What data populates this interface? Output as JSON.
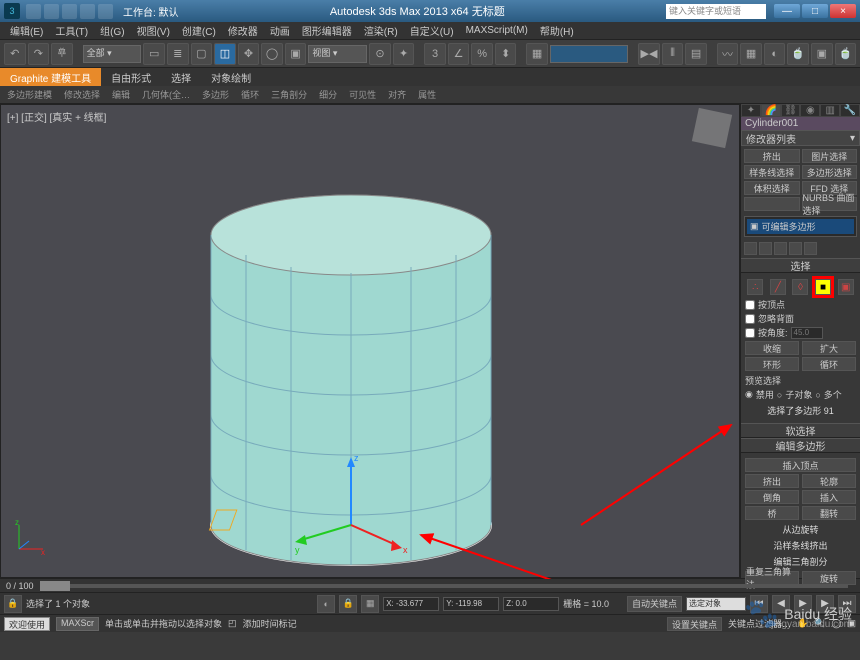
{
  "titlebar": {
    "workspace_label": "工作台: 默认",
    "app_title": "Autodesk 3ds Max  2013 x64   无标题",
    "search_placeholder": "键入关键字或短语",
    "min": "—",
    "max": "□",
    "close": "×"
  },
  "menu": [
    "编辑(E)",
    "工具(T)",
    "组(G)",
    "视图(V)",
    "创建(C)",
    "修改器",
    "动画",
    "图形编辑器",
    "渲染(R)",
    "自定义(U)",
    "MAXScript(M)",
    "帮助(H)"
  ],
  "toolbar_dropdown_all": "全部 ▾",
  "toolbar_dropdown_view": "视图 ▾",
  "ribbon": {
    "tabs": [
      "Graphite 建模工具",
      "自由形式",
      "选择",
      "对象绘制"
    ],
    "subtabs": [
      "多边形建模",
      "修改选择",
      "编辑",
      "几何体(全…",
      "多边形",
      "循环",
      "三角剖分",
      "细分",
      "可见性",
      "对齐",
      "属性"
    ]
  },
  "viewport_label": "[+] [正交] [真实 + 线框]",
  "panel": {
    "object_name": "Cylinder001",
    "modifier_list": "修改器列表",
    "buttons_top": [
      "挤出",
      "图片选择",
      "样条线选择",
      "多边形选择",
      "体积选择",
      "FFD 选择",
      "",
      "NURBS 曲面选择"
    ],
    "stack_item": "可编辑多边形",
    "rollout_select": "选择",
    "chk_vertex": "按顶点",
    "chk_backface": "忽略背面",
    "chk_angle": "按角度:",
    "angle_val": "45.0",
    "btn_shrink": "收缩",
    "btn_grow": "扩大",
    "btn_ring": "环形",
    "btn_loop": "循环",
    "preview_label": "预览选择",
    "radio_off": "禁用",
    "radio_sub": "子对象",
    "radio_multi": "多个",
    "sel_count": "选择了多边形 91",
    "rollout_soft": "软选择",
    "rollout_edit": "编辑多边形",
    "btn_insvert": "插入顶点",
    "btn_extrude": "挤出",
    "btn_outline": "轮廓",
    "btn_bevel": "倒角",
    "btn_inset": "插入",
    "btn_bridge": "桥",
    "btn_flip": "翻转",
    "lbl_hinge": "从边旋转",
    "lbl_extspline": "沿样条线挤出",
    "lbl_edittri": "编辑三角剖分",
    "btn_retri": "重复三角算法",
    "btn_turn": "旋转"
  },
  "timeline_label": "0 / 100",
  "status": {
    "sel_text": "选择了 1 个对象",
    "x": "X: -33.677",
    "y": "Y: -119.98",
    "z": "Z: 0.0",
    "grid": "栅格 = 10.0",
    "autokey": "自动关键点",
    "setkey_mode": "选定对象",
    "hint": "单击或单击并拖动以选择对象",
    "addtag": "添加时间标记",
    "setkey": "设置关键点",
    "keyfilter": "关键点过滤器…",
    "welcome": "欢迎使用",
    "maxscript": "MAXScr"
  },
  "watermark": {
    "brand": "Baidu 经验",
    "url": "jingyan.baidu.com"
  },
  "gizmo_axes": {
    "x": "x",
    "y": "y",
    "z": "z"
  }
}
